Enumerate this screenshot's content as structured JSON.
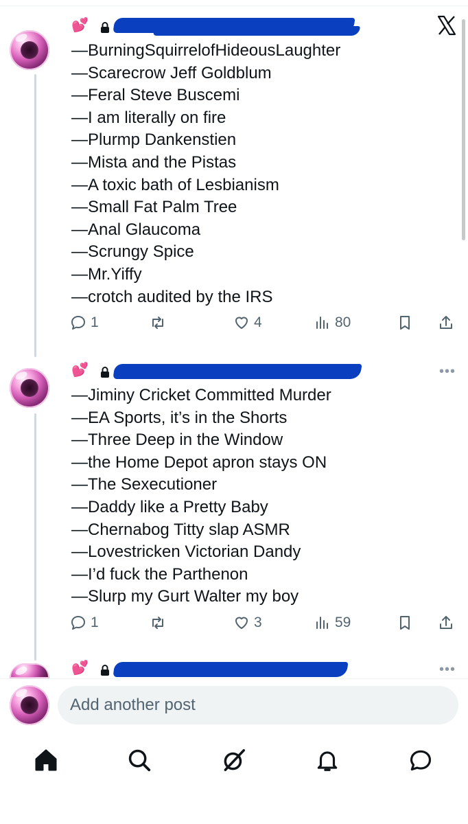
{
  "posts": [
    {
      "emoji": "💕",
      "lines": [
        "—BurningSquirrelofHideousLaughter",
        "—Scarecrow Jeff Goldblum",
        "—Feral Steve Buscemi",
        "—I am literally on fire",
        "—Plurmp Dankenstien",
        "—Mista and the Pistas",
        "—A toxic bath of Lesbianism",
        "—Small Fat Palm Tree",
        "—Anal Glaucoma",
        "—Scrungy Spice",
        "—Mr.Yiffy",
        "—crotch audited by the IRS"
      ],
      "replies": "1",
      "likes": "4",
      "views": "80"
    },
    {
      "emoji": "💕",
      "lines": [
        "—Jiminy Cricket Committed Murder",
        "—EA Sports, it’s in the Shorts",
        "—Three Deep in the Window",
        "—the Home Depot apron stays ON",
        "—The Sexecutioner",
        "—Daddy like a Pretty Baby",
        "—Chernabog Titty slap ASMR",
        "—Lovestricken Victorian Dandy",
        "—I’d fuck the Parthenon",
        "—Slurp my Gurt Walter my boy"
      ],
      "replies": "1",
      "likes": "3",
      "views": "59"
    },
    {
      "emoji": "💕"
    }
  ],
  "more_label": "•••",
  "compose": {
    "placeholder": "Add another post"
  },
  "nav": [
    "home-icon",
    "search-icon",
    "grok-icon",
    "notifications-icon",
    "messages-icon"
  ],
  "colors": {
    "redaction": "#0a3fc0",
    "muted": "#536471",
    "text": "#0f1419"
  }
}
